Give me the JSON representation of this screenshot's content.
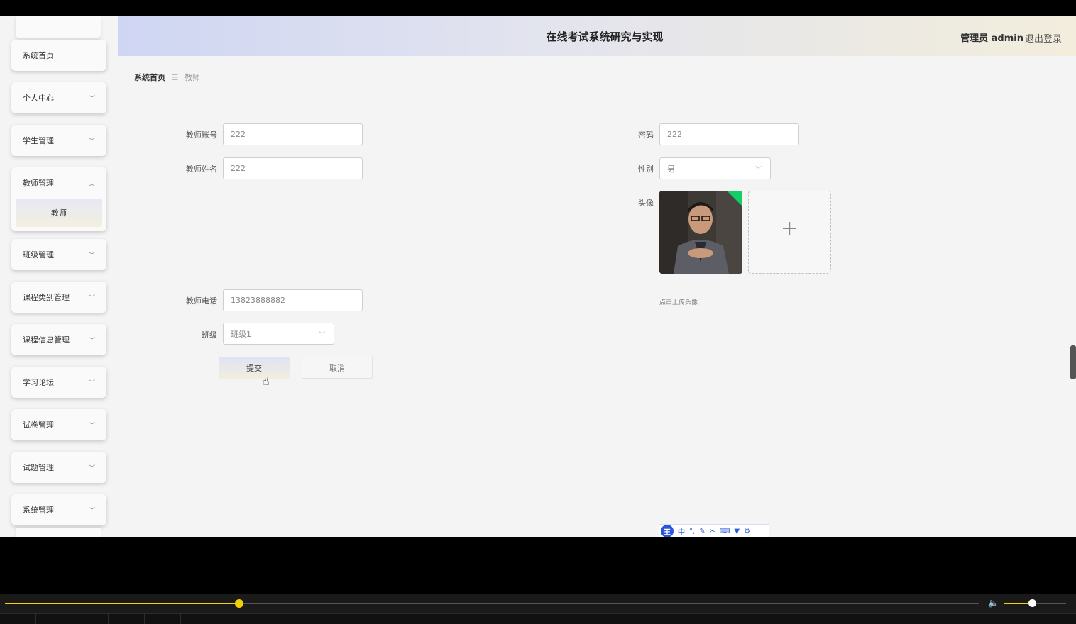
{
  "header": {
    "title": "在线考试系统研究与实现",
    "user": "管理员 admin",
    "logout": "退出登录"
  },
  "sidebar": {
    "items": [
      {
        "label": "系统首页"
      },
      {
        "label": "个人中心"
      },
      {
        "label": "学生管理"
      },
      {
        "label": "教师管理",
        "expanded": true,
        "children": [
          "教师"
        ]
      },
      {
        "label": "班级管理"
      },
      {
        "label": "课程类别管理"
      },
      {
        "label": "课程信息管理"
      },
      {
        "label": "学习论坛"
      },
      {
        "label": "试卷管理"
      },
      {
        "label": "试题管理"
      },
      {
        "label": "系统管理"
      }
    ]
  },
  "breadcrumb": {
    "home": "系统首页",
    "current": "教师"
  },
  "form": {
    "account_label": "教师账号",
    "account_value": "222",
    "password_label": "密码",
    "password_value": "222",
    "name_label": "教师姓名",
    "name_value": "222",
    "gender_label": "性别",
    "gender_value": "男",
    "avatar_label": "头像",
    "upload_hint": "点击上传头像",
    "phone_label": "教师电话",
    "phone_value": "13823888882",
    "class_label": "班级",
    "class_value": "班级1",
    "submit_label": "提交",
    "cancel_label": "取消"
  },
  "ime_toolbar": {
    "logo": "王",
    "mode": "中",
    "icons": [
      "punctuation-icon",
      "pen-icon",
      "scissors-icon",
      "keyboard-icon",
      "shirt-icon",
      "gear-icon"
    ]
  },
  "player": {
    "progress": 0.24,
    "volume": 0.45,
    "accent": "#f5d000"
  }
}
